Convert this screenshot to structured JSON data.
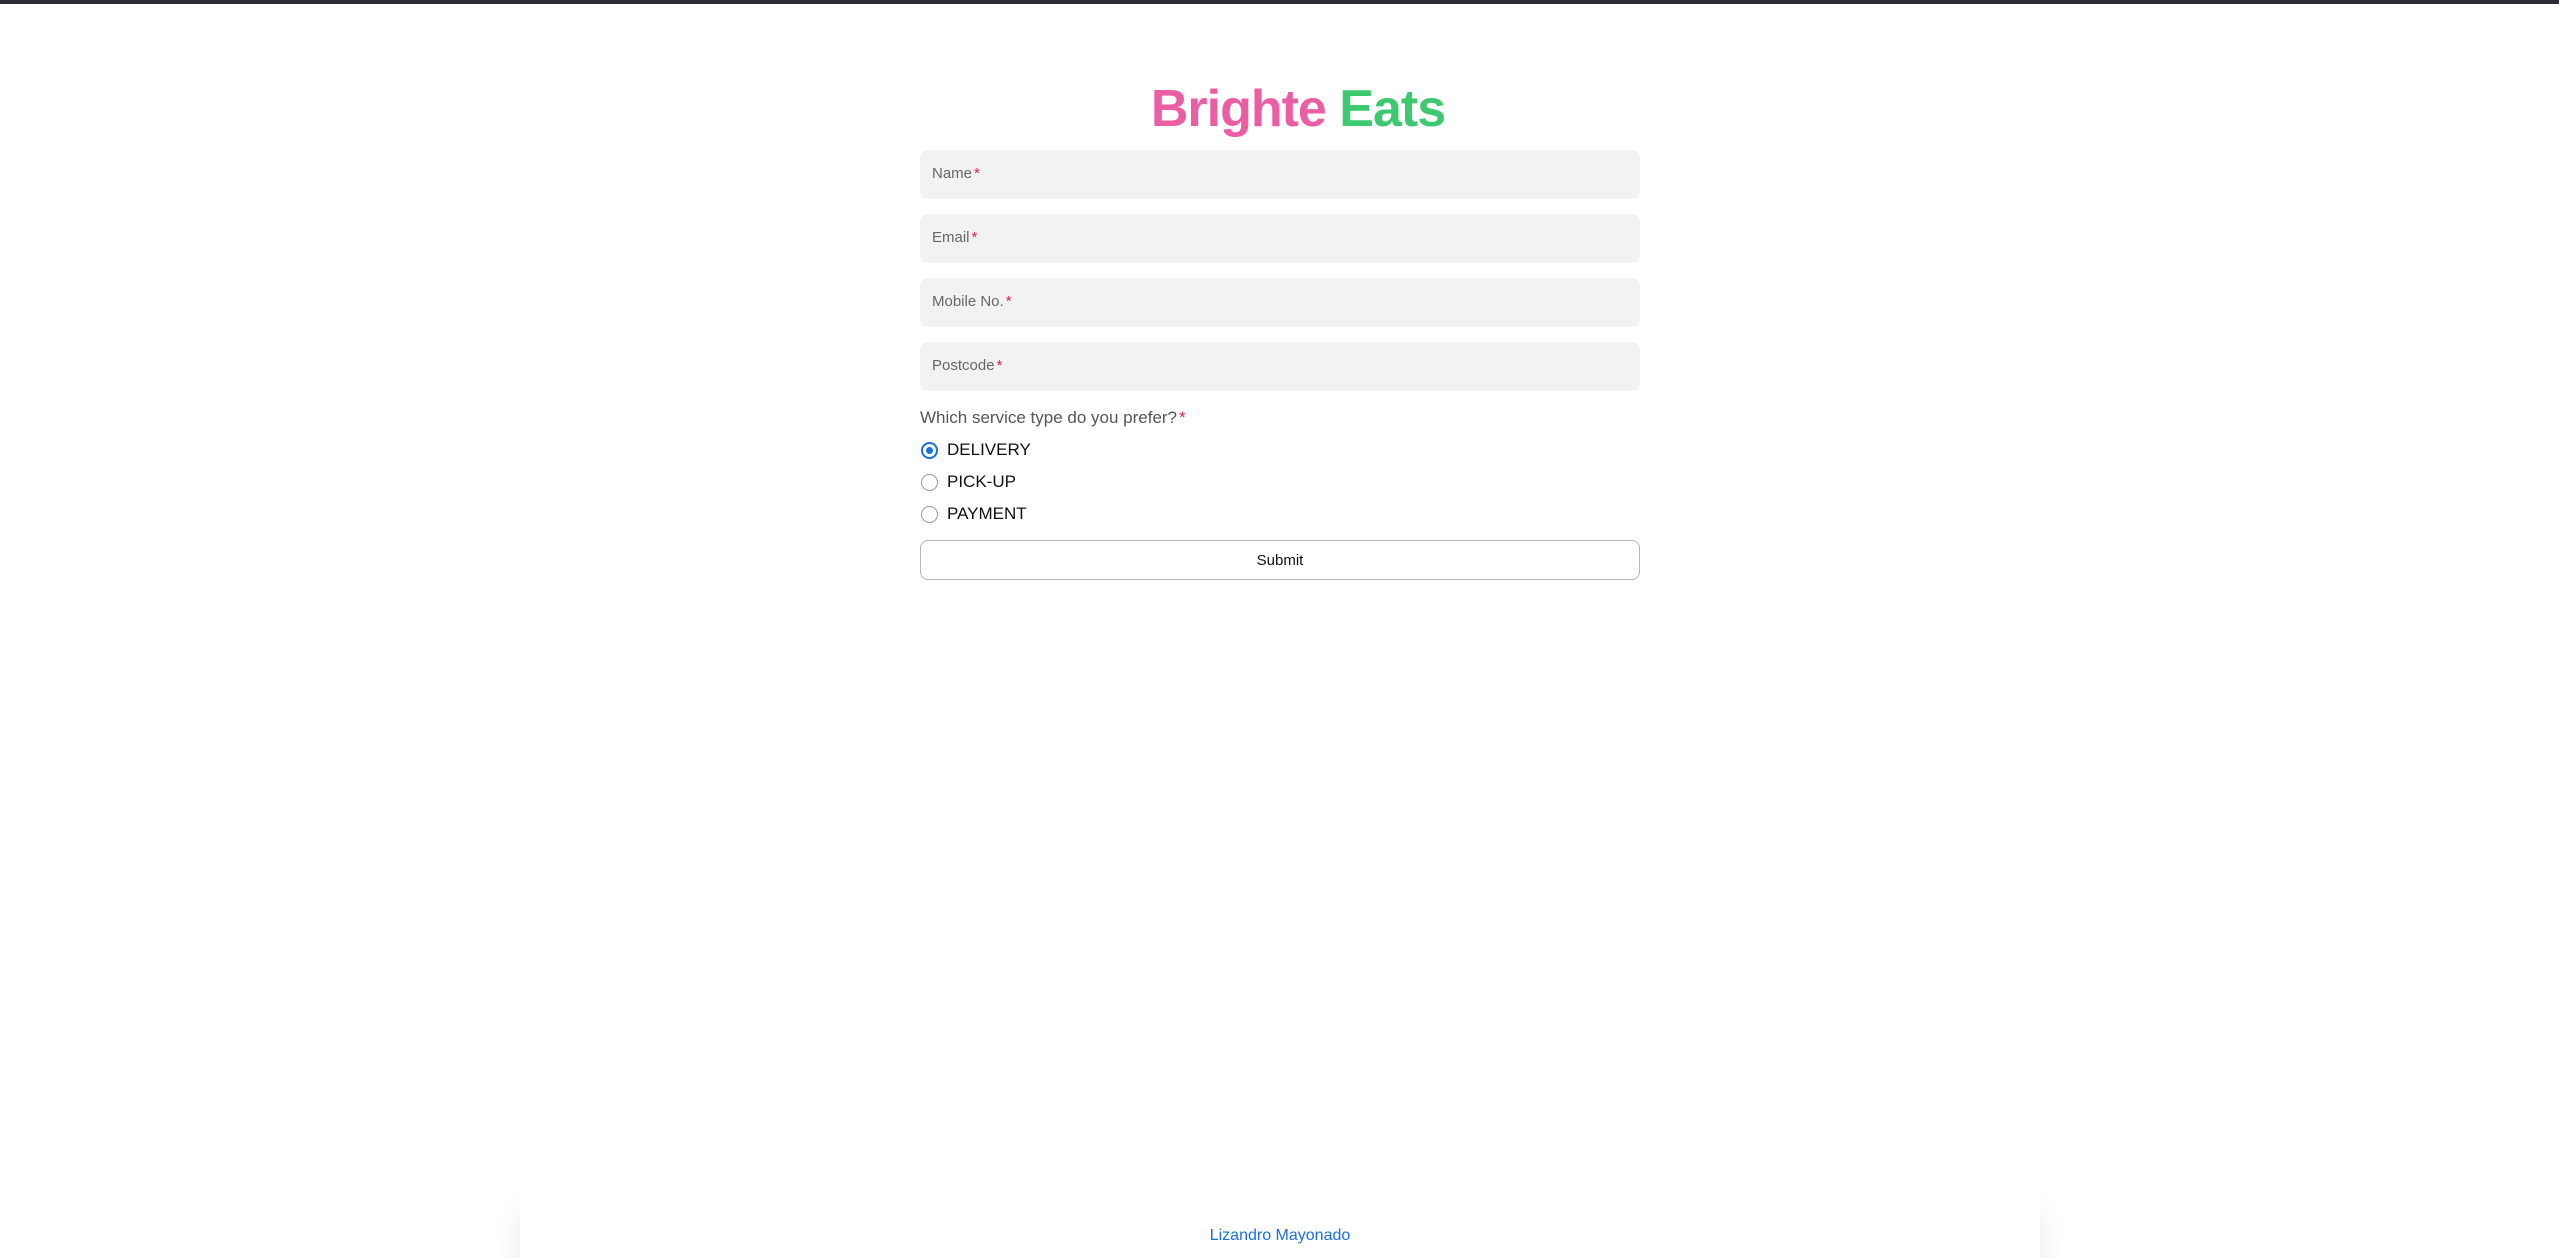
{
  "brand": {
    "part1": "Brighte",
    "part2": "Eats",
    "color1": "#ec5ea3",
    "color2": "#3cc96f"
  },
  "form": {
    "fields": [
      {
        "label": "Name",
        "required": "*",
        "value": ""
      },
      {
        "label": "Email",
        "required": "*",
        "value": ""
      },
      {
        "label": "Mobile No.",
        "required": "*",
        "value": ""
      },
      {
        "label": "Postcode",
        "required": "*",
        "value": ""
      }
    ],
    "question": "Which service type do you prefer?",
    "question_required": "*",
    "options": [
      {
        "label": "DELIVERY",
        "selected": true
      },
      {
        "label": "PICK-UP",
        "selected": false
      },
      {
        "label": "PAYMENT",
        "selected": false
      }
    ],
    "submit_label": "Submit"
  },
  "footer": {
    "link_text": "Lizandro Mayonado"
  },
  "colors": {
    "accent": "#1a6fe0",
    "required": "#e0243a",
    "field_bg": "#f2f2f2"
  }
}
